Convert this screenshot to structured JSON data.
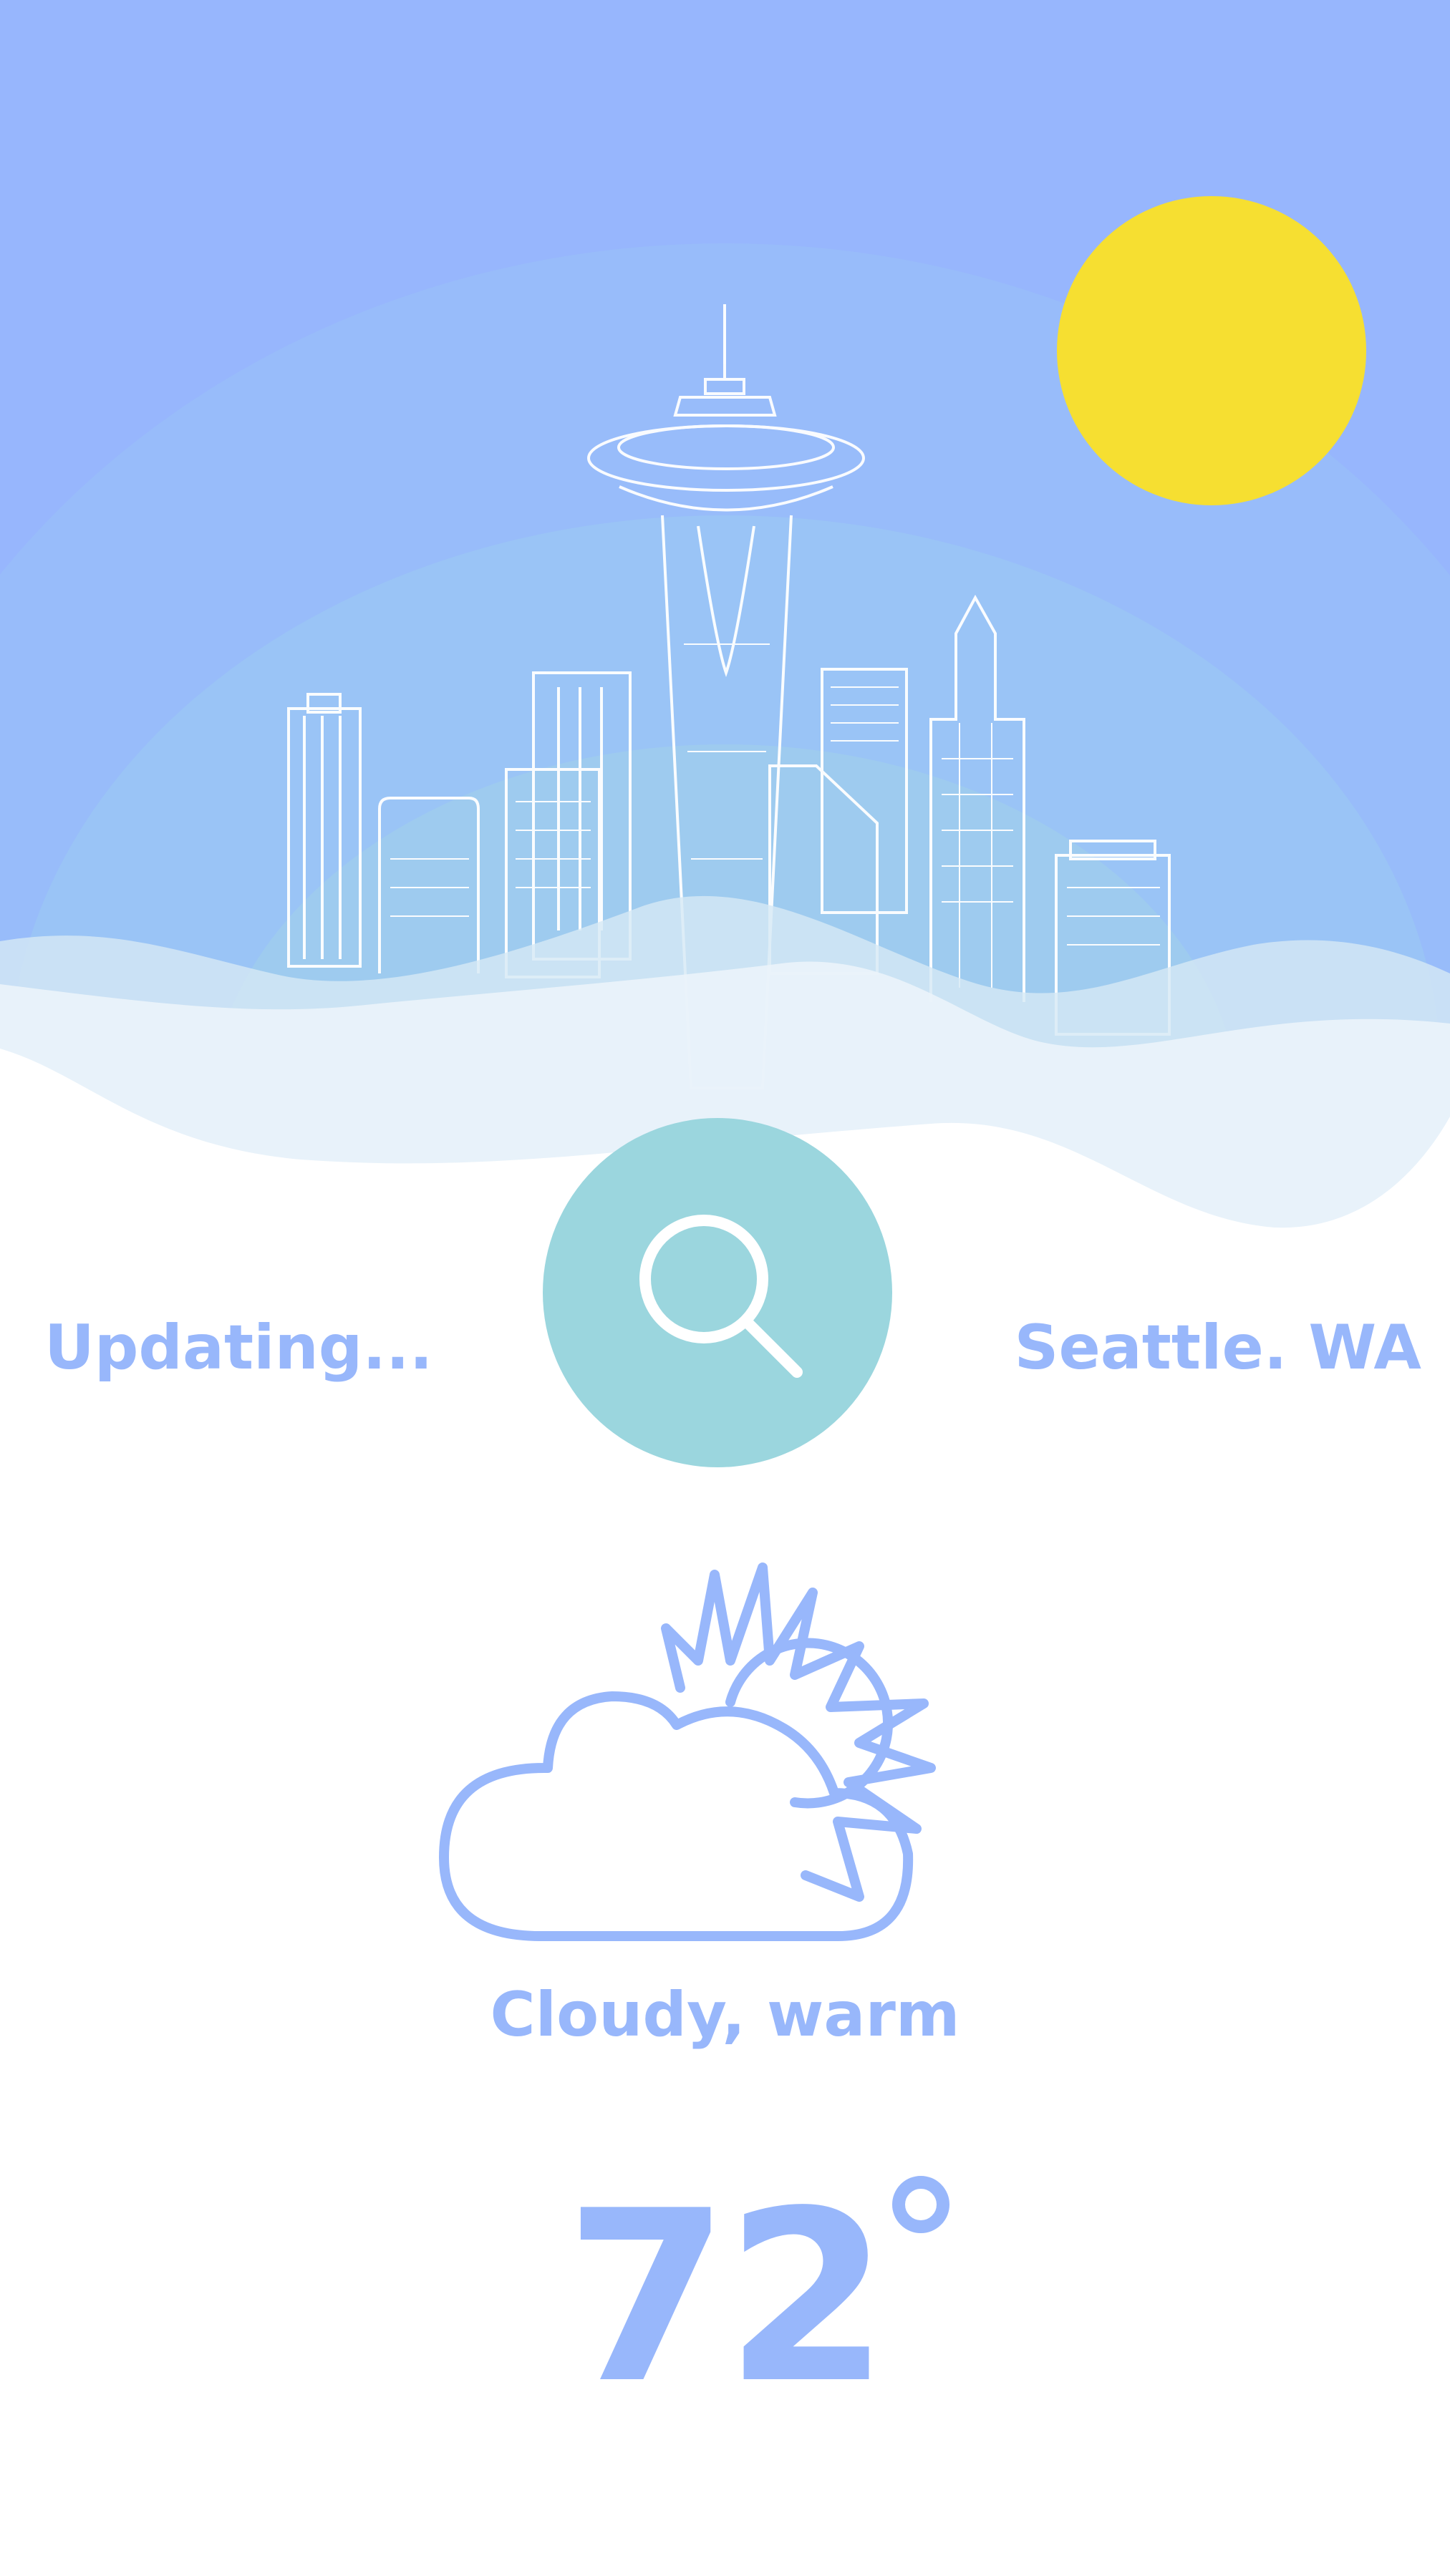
{
  "app": {
    "status_text": "Updating...",
    "location_text": "Seattle. WA",
    "condition_text": "Cloudy, warm",
    "temperature": "72"
  },
  "icons": {
    "search": "search-icon",
    "condition": "partly-cloudy-icon",
    "sun": "sun-icon",
    "degree": "degree-icon"
  },
  "colors": {
    "sky_top": "#97b6fd",
    "sky_mid": "#9ac2f8",
    "sun": "#f6df31",
    "accent_text": "#98b7fb",
    "search_button": "#9bd6de",
    "cloud_layer_1": "#d6e9f5",
    "cloud_layer_2": "#eaf3fa"
  }
}
